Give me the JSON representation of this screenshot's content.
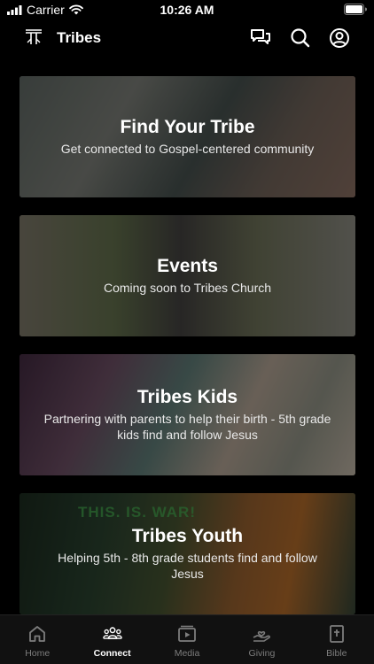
{
  "status_bar": {
    "carrier": "Carrier",
    "time": "10:26 AM"
  },
  "header": {
    "title": "Tribes"
  },
  "cards": [
    {
      "title": "Find Your Tribe",
      "subtitle": "Get connected to Gospel-centered community"
    },
    {
      "title": "Events",
      "subtitle": "Coming soon to Tribes Church"
    },
    {
      "title": "Tribes Kids",
      "subtitle": "Partnering with parents to help their birth - 5th grade kids find and follow Jesus"
    },
    {
      "title": "Tribes Youth",
      "subtitle": "Helping 5th - 8th grade students find and follow Jesus",
      "banner_text": "THIS. IS. WAR!"
    }
  ],
  "tabs": [
    {
      "label": "Home",
      "icon": "home-icon"
    },
    {
      "label": "Connect",
      "icon": "people-icon"
    },
    {
      "label": "Media",
      "icon": "play-icon"
    },
    {
      "label": "Giving",
      "icon": "hand-heart-icon"
    },
    {
      "label": "Bible",
      "icon": "bible-icon"
    }
  ],
  "active_tab": "Connect",
  "colors": {
    "background": "#000000",
    "tab_active": "#ffffff",
    "tab_inactive": "#7d7d7d"
  }
}
